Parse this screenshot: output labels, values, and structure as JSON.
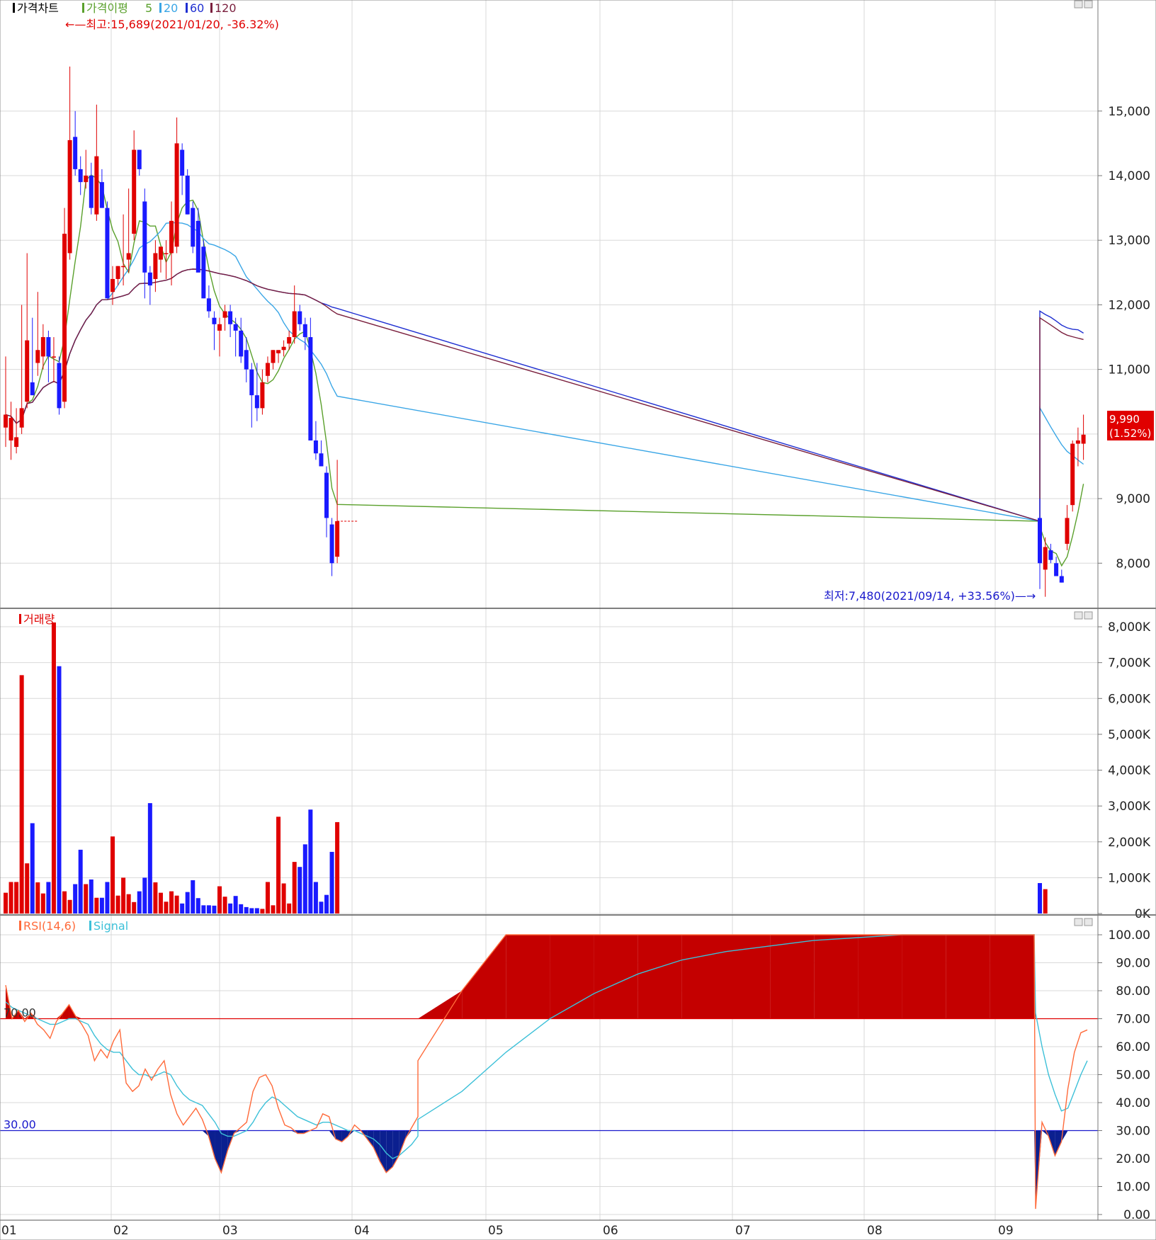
{
  "x_axis": {
    "labels": [
      "01",
      "02",
      "03",
      "04",
      "05",
      "06",
      "07",
      "08",
      "09"
    ]
  },
  "price_panel": {
    "legend": {
      "title": "가격차트",
      "ma_title": "가격이평",
      "periods": [
        "5",
        "20",
        "60",
        "120"
      ]
    },
    "colors": {
      "up": "#e00000",
      "down": "#1a1aff",
      "ma5": "#5aa02c",
      "ma20": "#3aa6e6",
      "ma60": "#1f2fd1",
      "ma120": "#7a1f3d"
    },
    "y_ticks": [
      "15,000",
      "14,000",
      "13,000",
      "12,000",
      "11,000",
      "10,000",
      "9,000",
      "8,000"
    ],
    "high_annotation": "←—최고:15,689(2021/01/20, -36.32%)",
    "low_annotation": "최저:7,480(2021/09/14, +33.56%)—→",
    "current_price": "9,990",
    "current_change": "(1.52%)"
  },
  "volume_panel": {
    "legend": "거래량",
    "y_ticks": [
      "8,000K",
      "7,000K",
      "6,000K",
      "5,000K",
      "4,000K",
      "3,000K",
      "2,000K",
      "1,000K",
      "0K"
    ]
  },
  "rsi_panel": {
    "legend": "RSI(14,6)",
    "signal_legend": "Signal",
    "upper_label": "70.00",
    "lower_label": "30.00",
    "y_ticks": [
      "100.00",
      "90.00",
      "80.00",
      "70.00",
      "60.00",
      "50.00",
      "40.00",
      "30.00",
      "20.00",
      "10.00",
      "0.00"
    ]
  },
  "chart_data": [
    {
      "type": "candlestick",
      "title": "가격차트",
      "ylim": [
        7400,
        16500
      ],
      "ohlc": [
        {
          "o": 10100,
          "h": 11200,
          "l": 9800,
          "c": 10300
        },
        {
          "o": 9900,
          "h": 10500,
          "l": 9600,
          "c": 10250
        },
        {
          "o": 9800,
          "h": 10400,
          "l": 9700,
          "c": 9950
        },
        {
          "o": 10100,
          "h": 12000,
          "l": 10000,
          "c": 10400
        },
        {
          "o": 10500,
          "h": 12800,
          "l": 10400,
          "c": 11450
        },
        {
          "o": 10800,
          "h": 11800,
          "l": 10600,
          "c": 10600
        },
        {
          "o": 11100,
          "h": 12200,
          "l": 10900,
          "c": 11300
        },
        {
          "o": 11200,
          "h": 11700,
          "l": 11000,
          "c": 11500
        },
        {
          "o": 11500,
          "h": 11600,
          "l": 10800,
          "c": 11200
        },
        {
          "o": 11200,
          "h": 11500,
          "l": 10800,
          "c": 11200
        },
        {
          "o": 11100,
          "h": 11200,
          "l": 10300,
          "c": 10400
        },
        {
          "o": 10500,
          "h": 13500,
          "l": 10400,
          "c": 13100
        },
        {
          "o": 12800,
          "h": 15689,
          "l": 12700,
          "c": 14550
        },
        {
          "o": 14600,
          "h": 15000,
          "l": 14000,
          "c": 14100
        },
        {
          "o": 14100,
          "h": 14300,
          "l": 13700,
          "c": 13900
        },
        {
          "o": 13900,
          "h": 14400,
          "l": 13800,
          "c": 14000
        },
        {
          "o": 14000,
          "h": 14200,
          "l": 13400,
          "c": 13500
        },
        {
          "o": 13400,
          "h": 15100,
          "l": 13300,
          "c": 14300
        },
        {
          "o": 13900,
          "h": 14100,
          "l": 13500,
          "c": 13500
        },
        {
          "o": 13500,
          "h": 13600,
          "l": 12100,
          "c": 12100
        },
        {
          "o": 12200,
          "h": 12600,
          "l": 12000,
          "c": 12400
        },
        {
          "o": 12400,
          "h": 12600,
          "l": 12300,
          "c": 12600
        },
        {
          "o": 12600,
          "h": 13400,
          "l": 12300,
          "c": 12600
        },
        {
          "o": 12700,
          "h": 13800,
          "l": 12500,
          "c": 12800
        },
        {
          "o": 13100,
          "h": 14700,
          "l": 13000,
          "c": 14400
        },
        {
          "o": 14400,
          "h": 14400,
          "l": 14000,
          "c": 14100
        },
        {
          "o": 13600,
          "h": 13800,
          "l": 12100,
          "c": 12500
        },
        {
          "o": 12500,
          "h": 12600,
          "l": 12000,
          "c": 12300
        },
        {
          "o": 12400,
          "h": 13000,
          "l": 12200,
          "c": 12800
        },
        {
          "o": 12700,
          "h": 12900,
          "l": 12500,
          "c": 12900
        },
        {
          "o": 12800,
          "h": 13000,
          "l": 12400,
          "c": 12800
        },
        {
          "o": 12800,
          "h": 13600,
          "l": 12300,
          "c": 13300
        },
        {
          "o": 12900,
          "h": 14900,
          "l": 12800,
          "c": 14500
        },
        {
          "o": 14400,
          "h": 14500,
          "l": 13700,
          "c": 14000
        },
        {
          "o": 14000,
          "h": 14100,
          "l": 13400,
          "c": 13400
        },
        {
          "o": 13500,
          "h": 13600,
          "l": 12800,
          "c": 12900
        },
        {
          "o": 13300,
          "h": 13500,
          "l": 12600,
          "c": 12500
        },
        {
          "o": 12900,
          "h": 13000,
          "l": 12100,
          "c": 12100
        },
        {
          "o": 12100,
          "h": 12300,
          "l": 11800,
          "c": 11900
        },
        {
          "o": 11800,
          "h": 11900,
          "l": 11300,
          "c": 11700
        },
        {
          "o": 11600,
          "h": 11800,
          "l": 11200,
          "c": 11700
        },
        {
          "o": 11800,
          "h": 12000,
          "l": 11600,
          "c": 11900
        },
        {
          "o": 11900,
          "h": 12000,
          "l": 11500,
          "c": 11700
        },
        {
          "o": 11700,
          "h": 11800,
          "l": 11200,
          "c": 11600
        },
        {
          "o": 11600,
          "h": 11800,
          "l": 11100,
          "c": 11200
        },
        {
          "o": 11300,
          "h": 11500,
          "l": 10800,
          "c": 11000
        },
        {
          "o": 11000,
          "h": 11100,
          "l": 10100,
          "c": 10600
        },
        {
          "o": 10600,
          "h": 11100,
          "l": 10200,
          "c": 10400
        },
        {
          "o": 10400,
          "h": 11000,
          "l": 10300,
          "c": 10800
        },
        {
          "o": 10900,
          "h": 11200,
          "l": 10800,
          "c": 11100
        },
        {
          "o": 11100,
          "h": 11300,
          "l": 11000,
          "c": 11300
        },
        {
          "o": 11250,
          "h": 11300,
          "l": 11100,
          "c": 11300
        },
        {
          "o": 11300,
          "h": 11450,
          "l": 11200,
          "c": 11350
        },
        {
          "o": 11400,
          "h": 11600,
          "l": 11300,
          "c": 11500
        },
        {
          "o": 11500,
          "h": 12300,
          "l": 11400,
          "c": 11900
        },
        {
          "o": 11900,
          "h": 12000,
          "l": 11600,
          "c": 11700
        },
        {
          "o": 11700,
          "h": 11800,
          "l": 11300,
          "c": 11500
        },
        {
          "o": 11500,
          "h": 11800,
          "l": 9900,
          "c": 9900
        },
        {
          "o": 9900,
          "h": 10200,
          "l": 9600,
          "c": 9700
        },
        {
          "o": 9700,
          "h": 9900,
          "l": 9500,
          "c": 9500
        },
        {
          "o": 9400,
          "h": 9500,
          "l": 8400,
          "c": 8700
        },
        {
          "o": 8600,
          "h": 8700,
          "l": 7800,
          "c": 8000
        },
        {
          "o": 8100,
          "h": 9600,
          "l": 8000,
          "c": 8650
        },
        {
          "type": "gap",
          "from": "2021-04",
          "to": "2021-09"
        },
        {
          "o": 8700,
          "h": 9000,
          "l": 7600,
          "c": 8000
        },
        {
          "o": 7900,
          "h": 8400,
          "l": 7480,
          "c": 8250
        },
        {
          "o": 8200,
          "h": 8300,
          "l": 8000,
          "c": 8050
        },
        {
          "o": 8000,
          "h": 8100,
          "l": 7800,
          "c": 7800
        },
        {
          "o": 7800,
          "h": 7900,
          "l": 7700,
          "c": 7700
        },
        {
          "o": 8300,
          "h": 8900,
          "l": 8200,
          "c": 8700
        },
        {
          "o": 8900,
          "h": 9900,
          "l": 8800,
          "c": 9850
        },
        {
          "o": 9850,
          "h": 10100,
          "l": 9500,
          "c": 9900
        },
        {
          "o": 9850,
          "h": 10300,
          "l": 9600,
          "c": 9990
        }
      ]
    },
    {
      "type": "bar",
      "title": "거래량",
      "unit": "K",
      "ylim": [
        0,
        8100
      ],
      "values": [
        580,
        880,
        880,
        6650,
        1400,
        2520,
        870,
        560,
        880,
        8120,
        6900,
        620,
        380,
        820,
        1780,
        820,
        950,
        440,
        440,
        880,
        2150,
        500,
        1000,
        540,
        320,
        620,
        1000,
        3080,
        870,
        580,
        330,
        620,
        500,
        280,
        600,
        930,
        430,
        230,
        230,
        220,
        760,
        470,
        280,
        490,
        260,
        180,
        150,
        150,
        130,
        880,
        230,
        2700,
        840,
        280,
        1440,
        1300,
        1930,
        2900,
        880,
        330,
        520,
        1720,
        2550,
        850,
        680
      ],
      "ylabel": "",
      "xlabel": ""
    },
    {
      "type": "line",
      "title": "RSI(14,6)",
      "series": [
        {
          "name": "RSI(14,6)",
          "values": [
            82,
            70,
            73,
            69,
            72,
            68,
            66,
            63,
            69,
            72,
            75,
            71,
            68,
            64,
            55,
            59,
            56,
            62,
            66,
            47,
            44,
            46,
            52,
            48,
            52,
            55,
            43,
            36,
            32,
            35,
            38,
            34,
            28,
            20,
            15,
            23,
            29,
            31,
            33,
            44,
            49,
            50,
            46,
            38,
            32,
            31,
            29,
            29,
            30,
            31,
            36,
            35,
            27,
            26,
            28,
            32,
            30,
            27,
            24,
            19,
            15,
            17,
            21,
            27,
            31,
            35,
            55,
            80,
            100,
            100,
            100,
            100,
            100,
            100,
            100,
            100,
            100,
            100,
            100,
            100,
            100,
            2,
            33,
            28,
            21,
            26,
            45,
            58,
            65,
            66
          ]
        },
        {
          "name": "Signal",
          "values": [
            76,
            74,
            73,
            72,
            71,
            70,
            69,
            68,
            68,
            69,
            70,
            70,
            69,
            68,
            64,
            61,
            59,
            58,
            58,
            55,
            52,
            50,
            50,
            49,
            50,
            51,
            50,
            46,
            43,
            41,
            40,
            39,
            36,
            33,
            29,
            28,
            28,
            29,
            30,
            33,
            37,
            40,
            42,
            41,
            39,
            37,
            35,
            34,
            33,
            32,
            33,
            33,
            32,
            31,
            30,
            30,
            29,
            28,
            27,
            25,
            22,
            20,
            21,
            23,
            25,
            28,
            34,
            44,
            58,
            70,
            79,
            86,
            91,
            94,
            96,
            98,
            99,
            100,
            100,
            100,
            100,
            72,
            60,
            50,
            43,
            37,
            38,
            44,
            50,
            55
          ]
        }
      ],
      "ylim": [
        0,
        100
      ],
      "levels": [
        70,
        30
      ]
    }
  ]
}
